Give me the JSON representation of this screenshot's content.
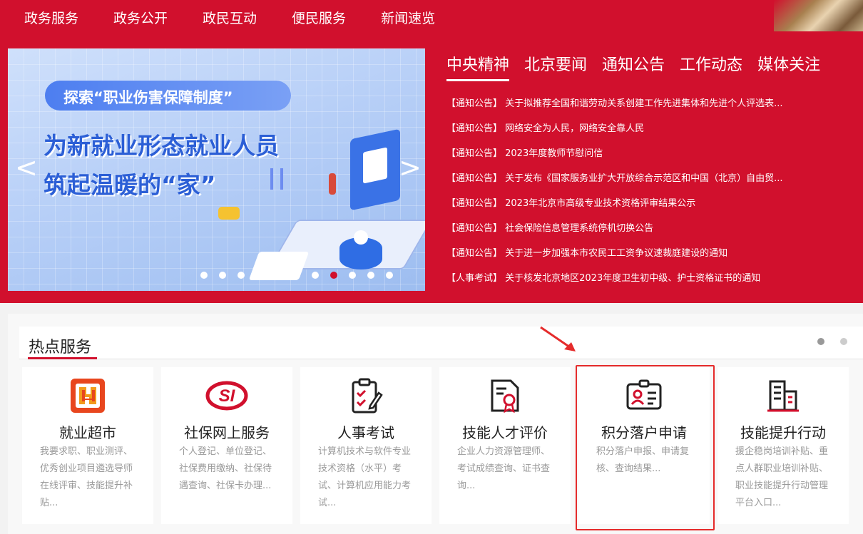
{
  "top_nav": [
    "政务服务",
    "政务公开",
    "政民互动",
    "便民服务",
    "新闻速览"
  ],
  "banner": {
    "pill_text": "探索“职业伤害保障制度”",
    "line1": "为新就业形态就业人员",
    "line2": "筑起温暖的“家”",
    "prev": "<",
    "next": ">",
    "slide_count": 11,
    "active_slide": 7
  },
  "news_tabs": [
    "中央精神",
    "北京要闻",
    "通知公告",
    "工作动态",
    "媒体关注"
  ],
  "active_news_tab": 0,
  "news": [
    "【通知公告】 关于拟推荐全国和谐劳动关系创建工作先进集体和先进个人评选表...",
    "【通知公告】 网络安全为人民，网络安全靠人民",
    "【通知公告】 2023年度教师节慰问信",
    "【通知公告】 关于发布《国家服务业扩大开放综合示范区和中国（北京）自由贸...",
    "【通知公告】 2023年北京市高级专业技术资格评审结果公示",
    "【通知公告】 社会保险信息管理系统停机切换公告",
    "【通知公告】 关于进一步加强本市农民工工资争议速裁庭建设的通知",
    "【人事考试】 关于核发北京地区2023年度卫生初中级、护士资格证书的通知"
  ],
  "hot_services": {
    "title": "热点服务",
    "pages": 2,
    "active_page": 0,
    "cards": [
      {
        "title": "就业超市",
        "desc": "我要求职、职业测评、优秀创业项目遴选导师在线评审、技能提升补贴...",
        "icon": "job-market-icon"
      },
      {
        "title": "社保网上服务",
        "desc": "个人登记、单位登记、社保费用缴纳、社保待遇查询、社保卡办理...",
        "icon": "social-security-logo-icon"
      },
      {
        "title": "人事考试",
        "desc": "计算机技术与软件专业技术资格（水平）考试、计算机应用能力考试...",
        "icon": "exam-clipboard-icon"
      },
      {
        "title": "技能人才评价",
        "desc": "企业人力资源管理师、考试成绩查询、证书查询...",
        "icon": "certificate-icon"
      },
      {
        "title": "积分落户申请",
        "desc": "积分落户申报、申请复核、查询结果...",
        "icon": "id-card-icon"
      },
      {
        "title": "技能提升行动",
        "desc": "援企稳岗培训补贴、重点人群职业培训补贴、职业技能提升行动管理平台入口...",
        "icon": "building-icon"
      }
    ]
  },
  "colors": {
    "brand_red": "#d1102d",
    "annotation_red": "#e52b2b"
  }
}
